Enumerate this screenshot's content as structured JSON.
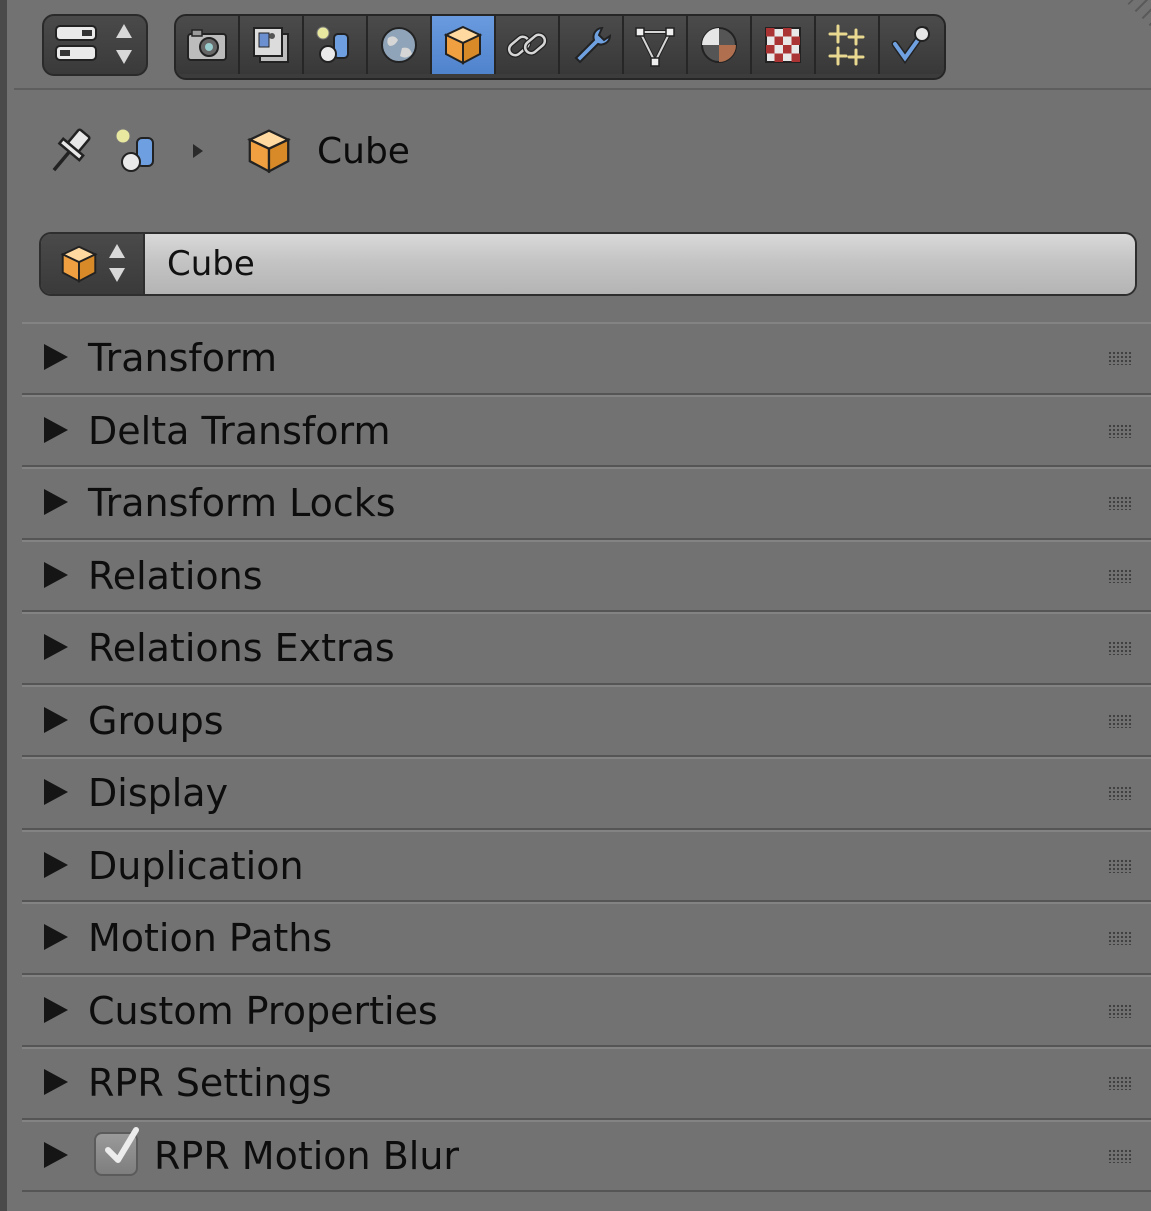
{
  "header": {
    "editor_type_icon": "properties-editor-icon",
    "tabs": [
      {
        "name": "render",
        "icon": "camera-icon",
        "active": false
      },
      {
        "name": "render-layers",
        "icon": "render-layers-icon",
        "active": false
      },
      {
        "name": "scene",
        "icon": "scene-icon",
        "active": false
      },
      {
        "name": "world",
        "icon": "world-icon",
        "active": false
      },
      {
        "name": "object",
        "icon": "cube-icon",
        "active": true
      },
      {
        "name": "constraints",
        "icon": "link-icon",
        "active": false
      },
      {
        "name": "modifiers",
        "icon": "wrench-icon",
        "active": false
      },
      {
        "name": "data",
        "icon": "mesh-data-icon",
        "active": false
      },
      {
        "name": "material",
        "icon": "material-sphere-icon",
        "active": false
      },
      {
        "name": "texture",
        "icon": "checker-texture-icon",
        "active": false
      },
      {
        "name": "particles",
        "icon": "sparkles-icon",
        "active": false
      },
      {
        "name": "physics",
        "icon": "physics-icon",
        "active": false
      }
    ]
  },
  "breadcrumb": {
    "object_name": "Cube"
  },
  "datablock": {
    "name": "Cube"
  },
  "panels": [
    {
      "label": "Transform"
    },
    {
      "label": "Delta Transform"
    },
    {
      "label": "Transform Locks"
    },
    {
      "label": "Relations"
    },
    {
      "label": "Relations Extras"
    },
    {
      "label": "Groups"
    },
    {
      "label": "Display"
    },
    {
      "label": "Duplication"
    },
    {
      "label": "Motion Paths"
    },
    {
      "label": "Custom Properties"
    },
    {
      "label": "RPR Settings"
    },
    {
      "label": "RPR Motion Blur",
      "checkbox": true
    }
  ],
  "colors": {
    "background": "#727272",
    "active_tab": "#5a8fd6",
    "cube_orange": "#f0a040"
  }
}
